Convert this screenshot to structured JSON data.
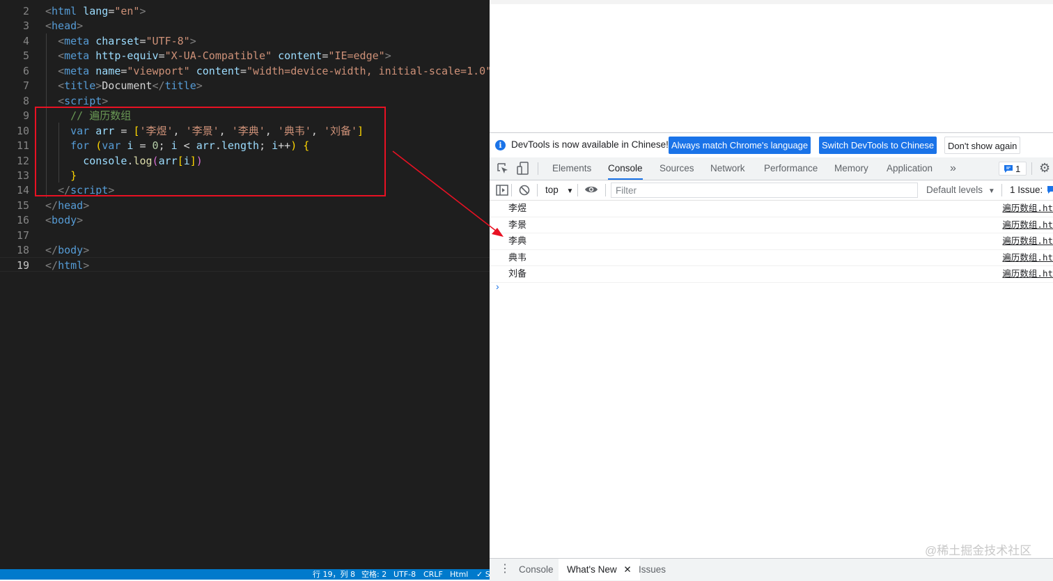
{
  "editor": {
    "lines": [
      {
        "num": "2",
        "segments": [
          [
            "tag",
            "<"
          ],
          [
            "tn",
            "html"
          ],
          [
            "tx",
            " "
          ],
          [
            "an",
            "lang"
          ],
          [
            "tx",
            "="
          ],
          [
            "av",
            "\"en\""
          ],
          [
            "tag",
            ">"
          ]
        ]
      },
      {
        "num": "3",
        "segments": [
          [
            "tag",
            "<"
          ],
          [
            "tn",
            "head"
          ],
          [
            "tag",
            ">"
          ]
        ]
      },
      {
        "num": "4",
        "segments": [
          [
            "tx",
            "  "
          ],
          [
            "tag",
            "<"
          ],
          [
            "tn",
            "meta"
          ],
          [
            "tx",
            " "
          ],
          [
            "an",
            "charset"
          ],
          [
            "tx",
            "="
          ],
          [
            "av",
            "\"UTF-8\""
          ],
          [
            "tag",
            ">"
          ]
        ]
      },
      {
        "num": "5",
        "segments": [
          [
            "tx",
            "  "
          ],
          [
            "tag",
            "<"
          ],
          [
            "tn",
            "meta"
          ],
          [
            "tx",
            " "
          ],
          [
            "an",
            "http-equiv"
          ],
          [
            "tx",
            "="
          ],
          [
            "av",
            "\"X-UA-Compatible\""
          ],
          [
            "tx",
            " "
          ],
          [
            "an",
            "content"
          ],
          [
            "tx",
            "="
          ],
          [
            "av",
            "\"IE=edge\""
          ],
          [
            "tag",
            ">"
          ]
        ]
      },
      {
        "num": "6",
        "segments": [
          [
            "tx",
            "  "
          ],
          [
            "tag",
            "<"
          ],
          [
            "tn",
            "meta"
          ],
          [
            "tx",
            " "
          ],
          [
            "an",
            "name"
          ],
          [
            "tx",
            "="
          ],
          [
            "av",
            "\"viewport\""
          ],
          [
            "tx",
            " "
          ],
          [
            "an",
            "content"
          ],
          [
            "tx",
            "="
          ],
          [
            "av",
            "\"width=device-width, initial-scale=1.0\""
          ],
          [
            "tag",
            ">"
          ]
        ]
      },
      {
        "num": "7",
        "segments": [
          [
            "tx",
            "  "
          ],
          [
            "tag",
            "<"
          ],
          [
            "tn",
            "title"
          ],
          [
            "tag",
            ">"
          ],
          [
            "tx",
            "Document"
          ],
          [
            "tag",
            "</"
          ],
          [
            "tn",
            "title"
          ],
          [
            "tag",
            ">"
          ]
        ]
      },
      {
        "num": "8",
        "segments": [
          [
            "tx",
            "  "
          ],
          [
            "tag",
            "<"
          ],
          [
            "tn",
            "script"
          ],
          [
            "tag",
            ">"
          ]
        ]
      },
      {
        "num": "9",
        "segments": [
          [
            "tx",
            "    "
          ],
          [
            "cm",
            "// 遍历数组"
          ]
        ]
      },
      {
        "num": "10",
        "segments": [
          [
            "tx",
            "    "
          ],
          [
            "kw",
            "var"
          ],
          [
            "tx",
            " "
          ],
          [
            "id",
            "arr"
          ],
          [
            "tx",
            " = "
          ],
          [
            "br",
            "["
          ],
          [
            "av",
            "'李煜'"
          ],
          [
            "tx",
            ", "
          ],
          [
            "av",
            "'李景'"
          ],
          [
            "tx",
            ", "
          ],
          [
            "av",
            "'李典'"
          ],
          [
            "tx",
            ", "
          ],
          [
            "av",
            "'典韦'"
          ],
          [
            "tx",
            ", "
          ],
          [
            "av",
            "'刘备'"
          ],
          [
            "br",
            "]"
          ]
        ]
      },
      {
        "num": "11",
        "segments": [
          [
            "tx",
            "    "
          ],
          [
            "kw",
            "for"
          ],
          [
            "tx",
            " "
          ],
          [
            "br",
            "("
          ],
          [
            "kw",
            "var"
          ],
          [
            "tx",
            " "
          ],
          [
            "id",
            "i"
          ],
          [
            "tx",
            " = "
          ],
          [
            "nm",
            "0"
          ],
          [
            "tx",
            "; "
          ],
          [
            "id",
            "i"
          ],
          [
            "tx",
            " < "
          ],
          [
            "id",
            "arr"
          ],
          [
            "tx",
            "."
          ],
          [
            "id",
            "length"
          ],
          [
            "tx",
            "; "
          ],
          [
            "id",
            "i"
          ],
          [
            "tx",
            "++"
          ],
          [
            "br",
            ")"
          ],
          [
            "tx",
            " "
          ],
          [
            "br",
            "{"
          ]
        ]
      },
      {
        "num": "12",
        "segments": [
          [
            "tx",
            "      "
          ],
          [
            "id",
            "console"
          ],
          [
            "tx",
            "."
          ],
          [
            "fn",
            "log"
          ],
          [
            "br2",
            "("
          ],
          [
            "id",
            "arr"
          ],
          [
            "br",
            "["
          ],
          [
            "id",
            "i"
          ],
          [
            "br",
            "]"
          ],
          [
            "br2",
            ")"
          ]
        ]
      },
      {
        "num": "13",
        "segments": [
          [
            "tx",
            "    "
          ],
          [
            "br",
            "}"
          ]
        ]
      },
      {
        "num": "14",
        "segments": [
          [
            "tx",
            "  "
          ],
          [
            "tag",
            "</"
          ],
          [
            "tn",
            "script"
          ],
          [
            "tag",
            ">"
          ]
        ]
      },
      {
        "num": "15",
        "segments": [
          [
            "tag",
            "</"
          ],
          [
            "tn",
            "head"
          ],
          [
            "tag",
            ">"
          ]
        ]
      },
      {
        "num": "16",
        "segments": [
          [
            "tag",
            "<"
          ],
          [
            "tn",
            "body"
          ],
          [
            "tag",
            ">"
          ]
        ]
      },
      {
        "num": "17",
        "segments": []
      },
      {
        "num": "18",
        "segments": [
          [
            "tag",
            "</"
          ],
          [
            "tn",
            "body"
          ],
          [
            "tag",
            ">"
          ]
        ]
      },
      {
        "num": "19",
        "segments": [
          [
            "tag",
            "</"
          ],
          [
            "tn",
            "html"
          ],
          [
            "tag",
            ">"
          ]
        ]
      }
    ],
    "active_line": "19"
  },
  "statusbar": {
    "cursor": "行 19，列 8",
    "indent": "空格: 2",
    "encoding": "UTF-8",
    "eol": "CRLF",
    "language": "Html",
    "check": "✓ S"
  },
  "devtools": {
    "infobar": {
      "text": "DevTools is now available in Chinese!",
      "btn_match": "Always match Chrome's language",
      "btn_switch": "Switch DevTools to Chinese",
      "btn_dont": "Don't show again"
    },
    "tabs": [
      "Elements",
      "Console",
      "Sources",
      "Network",
      "Performance",
      "Memory",
      "Application"
    ],
    "active_tab": "Console",
    "more_tabs": "»",
    "issues_badge": "1",
    "toolbar": {
      "context": "top",
      "filter_placeholder": "Filter",
      "levels": "Default levels",
      "issue_count": "1 Issue:"
    },
    "console_rows": [
      {
        "msg": "李煜",
        "src": "遍历数组.ht"
      },
      {
        "msg": "李景",
        "src": "遍历数组.ht"
      },
      {
        "msg": "李典",
        "src": "遍历数组.ht"
      },
      {
        "msg": "典韦",
        "src": "遍历数组.ht"
      },
      {
        "msg": "刘备",
        "src": "遍历数组.ht"
      }
    ],
    "prompt": "›",
    "drawer": {
      "tab_console": "Console",
      "tab_whatsnew": "What's New",
      "tab_issues": "Issues"
    }
  },
  "watermark": "@稀土掘金技术社区",
  "colors": {
    "highlight": "#e81123",
    "accent": "#1a73e8",
    "statusbar": "#007acc"
  }
}
